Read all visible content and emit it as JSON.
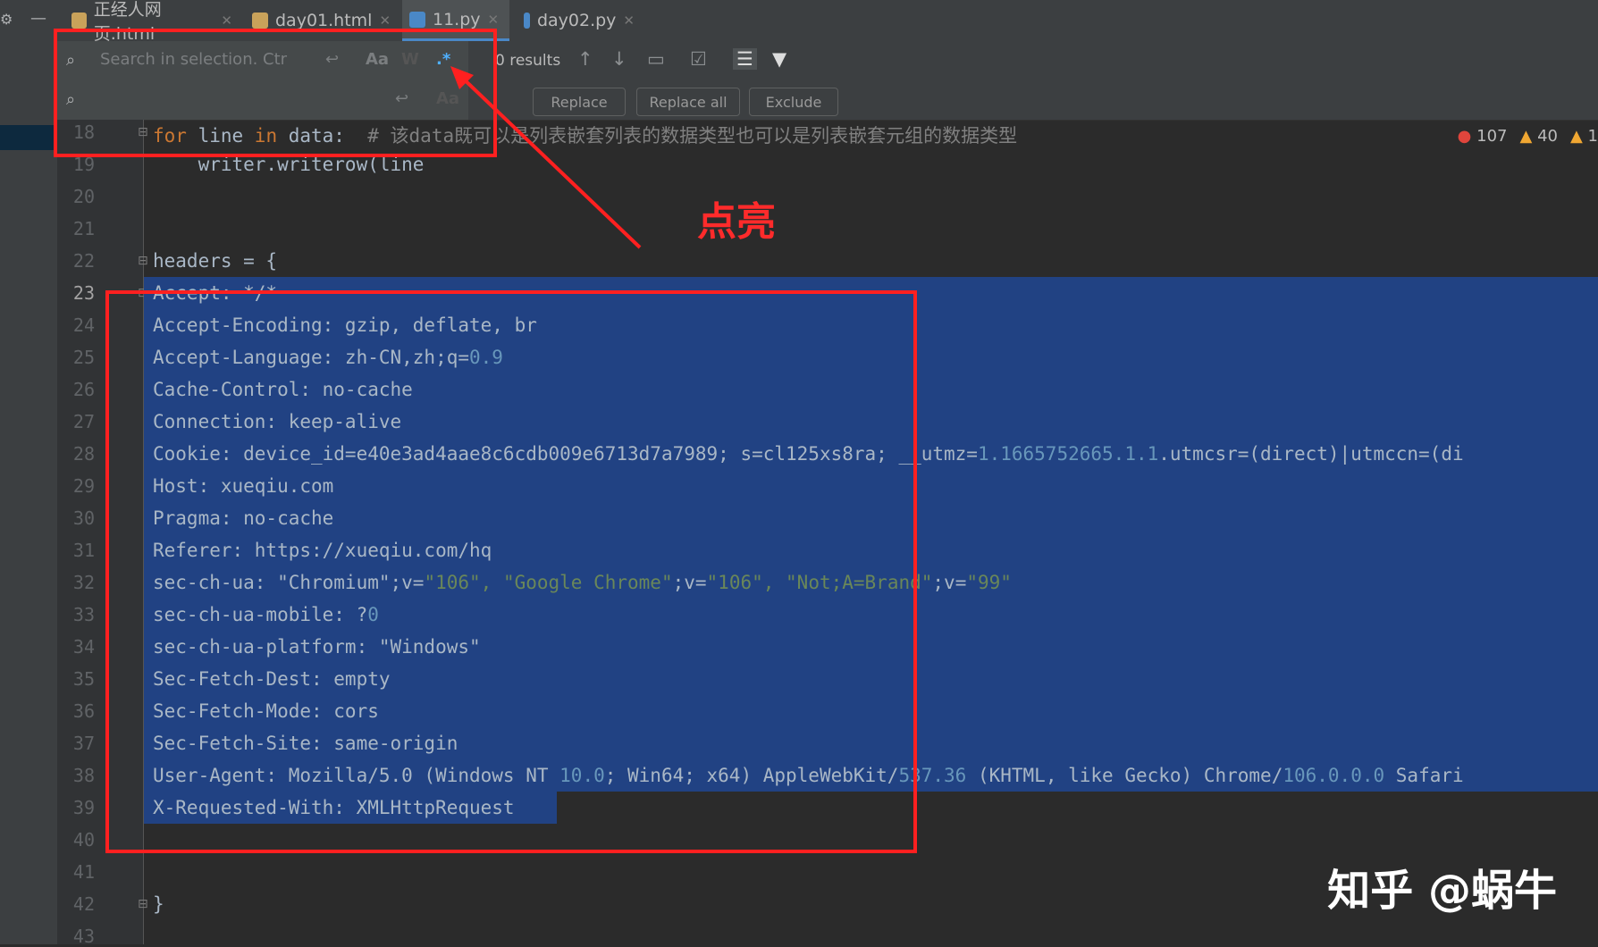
{
  "tabs": [
    {
      "label": "正经人网页.html",
      "active": false
    },
    {
      "label": "day01.html",
      "active": false
    },
    {
      "label": "11.py",
      "active": true
    },
    {
      "label": "day02.py",
      "active": false
    }
  ],
  "find": {
    "placeholder": "Search in selection. Ctr",
    "match_case": "Aa",
    "words": "W",
    "regex": ".*",
    "results": "0 results",
    "replace_btn": "Replace",
    "replace_all_btn": "Replace all",
    "exclude_btn": "Exclude"
  },
  "inspections": {
    "errors": "107",
    "warnings": "40",
    "weak": "1"
  },
  "line_numbers": [
    "18",
    "19",
    "20",
    "21",
    "22",
    "23",
    "24",
    "25",
    "26",
    "27",
    "28",
    "29",
    "30",
    "31",
    "32",
    "33",
    "34",
    "35",
    "36",
    "37",
    "38",
    "39",
    "40",
    "41",
    "42",
    "43"
  ],
  "code": {
    "l18_kw": "for",
    "l18_var": " line ",
    "l18_in": "in",
    "l18_rest": " data:  ",
    "l18_cm": "# 该data既可以是列表嵌套列表的数据类型也可以是列表嵌套元组的数据类型",
    "l19": "    writer.writerow(line",
    "l22": "headers = {",
    "l23": "Accept: */*",
    "l24": "Accept-Encoding: gzip, deflate, br",
    "l25a": "Accept-Language: zh-CN,zh;q=",
    "l25n": "0.9",
    "l26": "Cache-Control: no-cache",
    "l27": "Connection: keep-alive",
    "l28a": "Cookie: device_id=e40e3ad4aae8c6cdb009e6713d7a7989; s=cl125xs8ra; __utmz=",
    "l28n": "1.1665752665.1.1",
    "l28b": ".utmcsr=(direct)|utmccn=(di",
    "l29": "Host: xueqiu.com",
    "l30": "Pragma: no-cache",
    "l31": "Referer: https://xueqiu.com/hq",
    "l32a": "sec-ch-ua: \"Chromium\";v=",
    "l32s1": "\"106\", \"Google Chrome\"",
    "l32b": ";v=",
    "l32s2": "\"106\", \"Not;A=Brand\"",
    "l32c": ";v=",
    "l32s3": "\"99\"",
    "l33a": "sec-ch-ua-mobile: ?",
    "l33n": "0",
    "l34": "sec-ch-ua-platform: \"Windows\"",
    "l35": "Sec-Fetch-Dest: empty",
    "l36": "Sec-Fetch-Mode: cors",
    "l37": "Sec-Fetch-Site: same-origin",
    "l38a": "User-Agent: Mozilla/5.0 (Windows NT ",
    "l38n1": "10.0",
    "l38b": "; Win64; x64) AppleWebKit/",
    "l38n2": "537.36",
    "l38c": " (KHTML, like Gecko) Chrome/",
    "l38n3": "106.0.0.0",
    "l38d": " Safari",
    "l39": "X-Requested-With: XMLHttpRequest",
    "l42": "}"
  },
  "annotation": {
    "note": "点亮"
  },
  "watermark": "知乎 @蜗牛",
  "colors": {
    "selection": "#214283",
    "annotation": "#ff2020",
    "keyword": "#cc7832",
    "number": "#6897bb"
  }
}
